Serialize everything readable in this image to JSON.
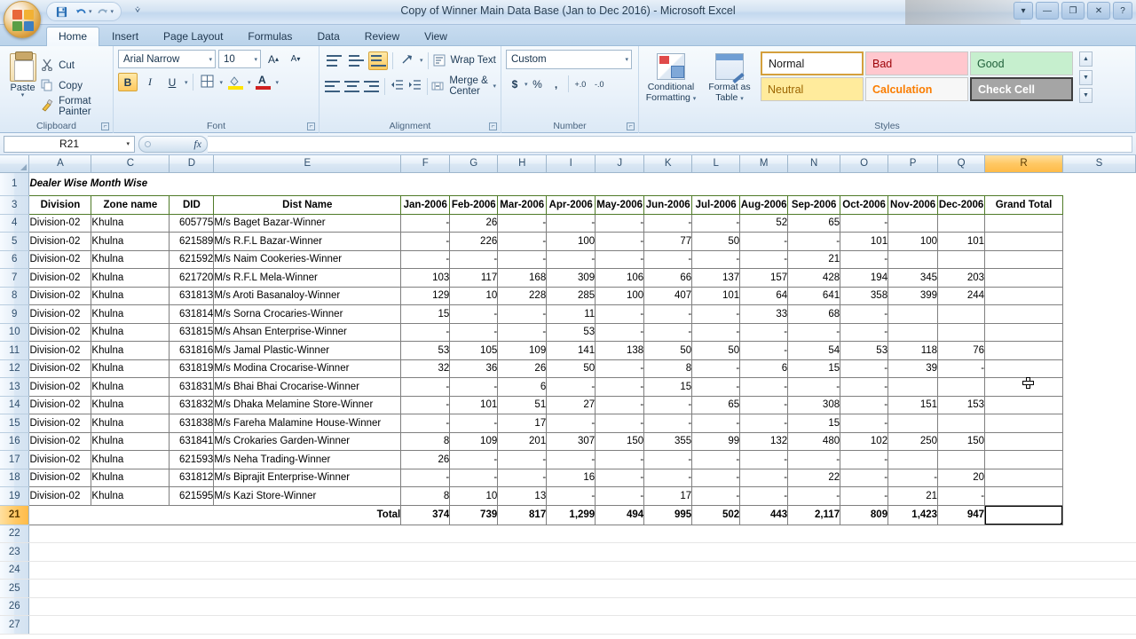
{
  "window": {
    "title": "Copy of Winner Main Data Base (Jan to Dec 2016) - Microsoft Excel",
    "minimize": "—",
    "restore": "❐",
    "close": "✕",
    "help": "?"
  },
  "quick_access": {
    "save": "save-icon",
    "undo": "undo-icon",
    "redo": "redo-icon",
    "customize": "customize-icon"
  },
  "tabs": [
    {
      "label": "Home",
      "active": true
    },
    {
      "label": "Insert",
      "active": false
    },
    {
      "label": "Page Layout",
      "active": false
    },
    {
      "label": "Formulas",
      "active": false
    },
    {
      "label": "Data",
      "active": false
    },
    {
      "label": "Review",
      "active": false
    },
    {
      "label": "View",
      "active": false
    }
  ],
  "ribbon": {
    "clipboard": {
      "group_label": "Clipboard",
      "paste": "Paste",
      "cut": "Cut",
      "copy": "Copy",
      "format_painter": "Format Painter"
    },
    "font": {
      "group_label": "Font",
      "font_name": "Arial Narrow",
      "font_size": "10",
      "grow_font": "A",
      "shrink_font": "A",
      "bold": "B",
      "italic": "I",
      "underline": "U",
      "borders": "borders-icon",
      "fill_color": "fill-color-icon",
      "font_color": "font-color-icon"
    },
    "alignment": {
      "group_label": "Alignment",
      "wrap_text": "Wrap Text",
      "merge_center": "Merge & Center",
      "orientation": "orientation-icon"
    },
    "number": {
      "group_label": "Number",
      "format": "Custom",
      "currency": "$",
      "percent": "%",
      "comma": ",",
      "increase_decimal": "+.0",
      "decrease_decimal": "-.0"
    },
    "styles": {
      "group_label": "Styles",
      "conditional_formatting": "Conditional Formatting",
      "format_as_table": "Format as Table",
      "cells": [
        {
          "label": "Normal",
          "key": "s-normal"
        },
        {
          "label": "Bad",
          "key": "s-bad"
        },
        {
          "label": "Good",
          "key": "s-good"
        },
        {
          "label": "Neutral",
          "key": "s-neutral"
        },
        {
          "label": "Calculation",
          "key": "s-calc"
        },
        {
          "label": "Check Cell",
          "key": "s-check"
        }
      ]
    }
  },
  "formula_bar": {
    "name_box": "R21",
    "formula": "",
    "fx_label": "fx"
  },
  "grid": {
    "columns": [
      "A",
      "C",
      "D",
      "E",
      "F",
      "G",
      "H",
      "I",
      "J",
      "K",
      "L",
      "M",
      "N",
      "O",
      "P",
      "Q",
      "R",
      "S"
    ],
    "selected_column": "R",
    "selected_row": "21",
    "row_numbers_visible": [
      "1",
      "3",
      "4",
      "5",
      "6",
      "7",
      "8",
      "9",
      "10",
      "11",
      "12",
      "13",
      "14",
      "15",
      "16",
      "17",
      "18",
      "19",
      "21",
      "22",
      "23",
      "24",
      "25",
      "26",
      "27"
    ],
    "sheet_title": "Dealer Wise Month Wise",
    "headers": [
      "Division",
      "Zone name",
      "DID",
      "Dist Name",
      "Jan-2006",
      "Feb-2006",
      "Mar-2006",
      "Apr-2006",
      "May-2006",
      "Jun-2006",
      "Jul-2006",
      "Aug-2006",
      "Sep-2006",
      "Oct-2006",
      "Nov-2006",
      "Dec-2006",
      "Grand Total"
    ],
    "rows": [
      {
        "n": "4",
        "division": "Division-02",
        "zone": "Khulna",
        "did": "605775",
        "dist": "M/s Baget Bazar-Winner",
        "months": [
          "-",
          "26",
          "-",
          "-",
          "-",
          "-",
          "-",
          "52",
          "65",
          "-",
          "",
          "",
          ""
        ],
        "total": ""
      },
      {
        "n": "5",
        "division": "Division-02",
        "zone": "Khulna",
        "did": "621589",
        "dist": "M/s R.F.L Bazar-Winner",
        "months": [
          "-",
          "226",
          "-",
          "100",
          "-",
          "77",
          "50",
          "-",
          "-",
          "101",
          "100",
          "101",
          ""
        ],
        "total": ""
      },
      {
        "n": "6",
        "division": "Division-02",
        "zone": "Khulna",
        "did": "621592",
        "dist": "M/s Naim Cookeries-Winner",
        "months": [
          "-",
          "-",
          "-",
          "-",
          "-",
          "-",
          "-",
          "-",
          "21",
          "-",
          "",
          "",
          ""
        ],
        "total": ""
      },
      {
        "n": "7",
        "division": "Division-02",
        "zone": "Khulna",
        "did": "621720",
        "dist": "M/s R.F.L Mela-Winner",
        "months": [
          "103",
          "117",
          "168",
          "309",
          "106",
          "66",
          "137",
          "157",
          "428",
          "194",
          "345",
          "203",
          ""
        ],
        "total": ""
      },
      {
        "n": "8",
        "division": "Division-02",
        "zone": "Khulna",
        "did": "631813",
        "dist": "M/s Aroti Basanaloy-Winner",
        "months": [
          "129",
          "10",
          "228",
          "285",
          "100",
          "407",
          "101",
          "64",
          "641",
          "358",
          "399",
          "244",
          ""
        ],
        "total": ""
      },
      {
        "n": "9",
        "division": "Division-02",
        "zone": "Khulna",
        "did": "631814",
        "dist": "M/s Sorna Crocaries-Winner",
        "months": [
          "15",
          "-",
          "-",
          "11",
          "-",
          "-",
          "-",
          "33",
          "68",
          "-",
          "",
          "",
          ""
        ],
        "total": ""
      },
      {
        "n": "10",
        "division": "Division-02",
        "zone": "Khulna",
        "did": "631815",
        "dist": "M/s Ahsan Enterprise-Winner",
        "months": [
          "-",
          "-",
          "-",
          "53",
          "-",
          "-",
          "-",
          "-",
          "-",
          "-",
          "",
          "",
          ""
        ],
        "total": ""
      },
      {
        "n": "11",
        "division": "Division-02",
        "zone": "Khulna",
        "did": "631816",
        "dist": "M/s Jamal Plastic-Winner",
        "months": [
          "53",
          "105",
          "109",
          "141",
          "138",
          "50",
          "50",
          "-",
          "54",
          "53",
          "118",
          "76",
          ""
        ],
        "total": ""
      },
      {
        "n": "12",
        "division": "Division-02",
        "zone": "Khulna",
        "did": "631819",
        "dist": "M/s Modina Crocarise-Winner",
        "months": [
          "32",
          "36",
          "26",
          "50",
          "-",
          "8",
          "-",
          "6",
          "15",
          "-",
          "39",
          "-",
          ""
        ],
        "total": ""
      },
      {
        "n": "13",
        "division": "Division-02",
        "zone": "Khulna",
        "did": "631831",
        "dist": "M/s Bhai Bhai Crocarise-Winner",
        "months": [
          "-",
          "-",
          "6",
          "-",
          "-",
          "15",
          "-",
          "-",
          "-",
          "-",
          "",
          "",
          ""
        ],
        "total": ""
      },
      {
        "n": "14",
        "division": "Division-02",
        "zone": "Khulna",
        "did": "631832",
        "dist": "M/s Dhaka Melamine Store-Winner",
        "months": [
          "-",
          "101",
          "51",
          "27",
          "-",
          "-",
          "65",
          "-",
          "308",
          "-",
          "151",
          "153",
          ""
        ],
        "total": ""
      },
      {
        "n": "15",
        "division": "Division-02",
        "zone": "Khulna",
        "did": "631838",
        "dist": "M/s Fareha Malamine House-Winner",
        "months": [
          "-",
          "-",
          "17",
          "-",
          "-",
          "-",
          "-",
          "-",
          "15",
          "-",
          "",
          "",
          ""
        ],
        "total": ""
      },
      {
        "n": "16",
        "division": "Division-02",
        "zone": "Khulna",
        "did": "631841",
        "dist": "M/s Crokaries Garden-Winner",
        "months": [
          "8",
          "109",
          "201",
          "307",
          "150",
          "355",
          "99",
          "132",
          "480",
          "102",
          "250",
          "150",
          ""
        ],
        "total": ""
      },
      {
        "n": "17",
        "division": "Division-02",
        "zone": "Khulna",
        "did": "621593",
        "dist": "M/s Neha Trading-Winner",
        "months": [
          "26",
          "-",
          "-",
          "-",
          "-",
          "-",
          "-",
          "-",
          "-",
          "-",
          "",
          "",
          ""
        ],
        "total": ""
      },
      {
        "n": "18",
        "division": "Division-02",
        "zone": "Khulna",
        "did": "631812",
        "dist": "M/s Biprajit Enterprise-Winner",
        "months": [
          "-",
          "-",
          "-",
          "16",
          "-",
          "-",
          "-",
          "-",
          "22",
          "-",
          "-",
          "20",
          ""
        ],
        "total": ""
      },
      {
        "n": "19",
        "division": "Division-02",
        "zone": "Khulna",
        "did": "621595",
        "dist": "M/s Kazi Store-Winner",
        "months": [
          "8",
          "10",
          "13",
          "-",
          "-",
          "17",
          "-",
          "-",
          "-",
          "-",
          "21",
          "-",
          ""
        ],
        "total": ""
      }
    ],
    "total_row": {
      "n": "21",
      "label": "Total",
      "months": [
        "374",
        "739",
        "817",
        "1,299",
        "494",
        "995",
        "502",
        "443",
        "2,117",
        "809",
        "1,423",
        "947"
      ],
      "total": ""
    },
    "empty_rows": [
      "22",
      "23",
      "24",
      "25",
      "26",
      "27"
    ]
  },
  "colors": {
    "header_green": "#92d050",
    "grand_total_blue": "#00b0f0",
    "title_blue": "#1f5fbf",
    "selection_orange": "#ffc864"
  }
}
